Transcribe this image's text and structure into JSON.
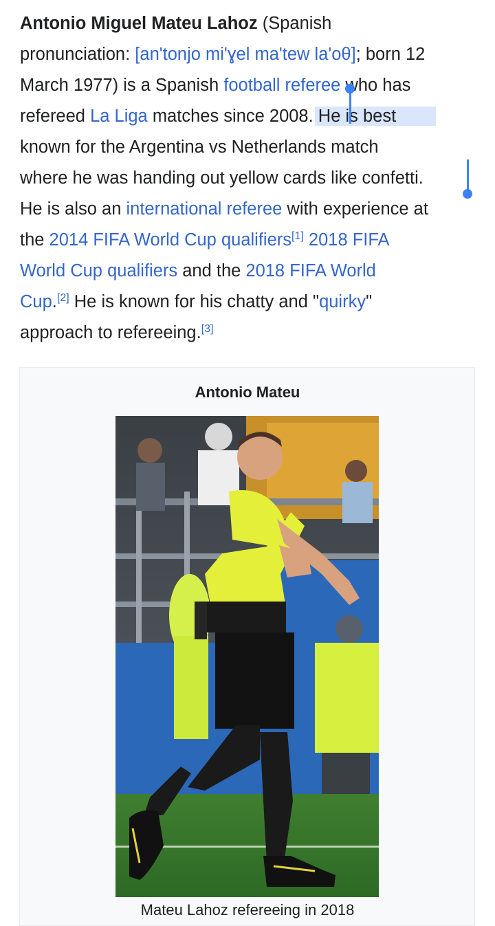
{
  "article": {
    "subject_name": "Antonio Miguel Mateu Lahoz",
    "lang_intro": " (Spanish",
    "pron_label": "pronunciation: ",
    "ipa": "[an'tonjo mi'ɣel ma'tew la'oθ]",
    "born_text": "; born 12",
    "born_date_rest": "March 1977) is a Spanish ",
    "link_football_referee": "football referee",
    "who_has": " who has",
    "refereed": "refereed ",
    "link_la_liga": "La Liga",
    "matches_since": " matches since 2008. ",
    "sel_line1": "He is best",
    "sel_line2": "known for the Argentina vs Netherlands match",
    "sel_line3": "where he was handing out yellow cards like confetti.",
    "also_text": "He is also an ",
    "link_international_referee": "international referee",
    "with_exp": " with experience at",
    "the": "the ",
    "link_2014_qualifiers": "2014 FIFA World Cup qualifiers",
    "ref1": "[1]",
    "link_2018_fifa": " 2018 FIFA",
    "link_2018_qualifiers": "World Cup qualifiers",
    "and_the": " and the ",
    "link_2018_world": "2018 FIFA World",
    "link_cup": "Cup",
    "period": ".",
    "ref2": "[2]",
    "known_for": " He is known for his chatty and \"",
    "link_quirky": "quirky",
    "quote_close": "\"",
    "approach": "approach to refereeing.",
    "ref3": "[3]"
  },
  "infobox": {
    "title": "Antonio Mateu",
    "caption": "Mateu Lahoz refereeing in 2018"
  },
  "colors": {
    "link": "#3366cc",
    "selection": "#d9e6fb",
    "selection_handle": "#3b82f6",
    "text": "#202122"
  }
}
